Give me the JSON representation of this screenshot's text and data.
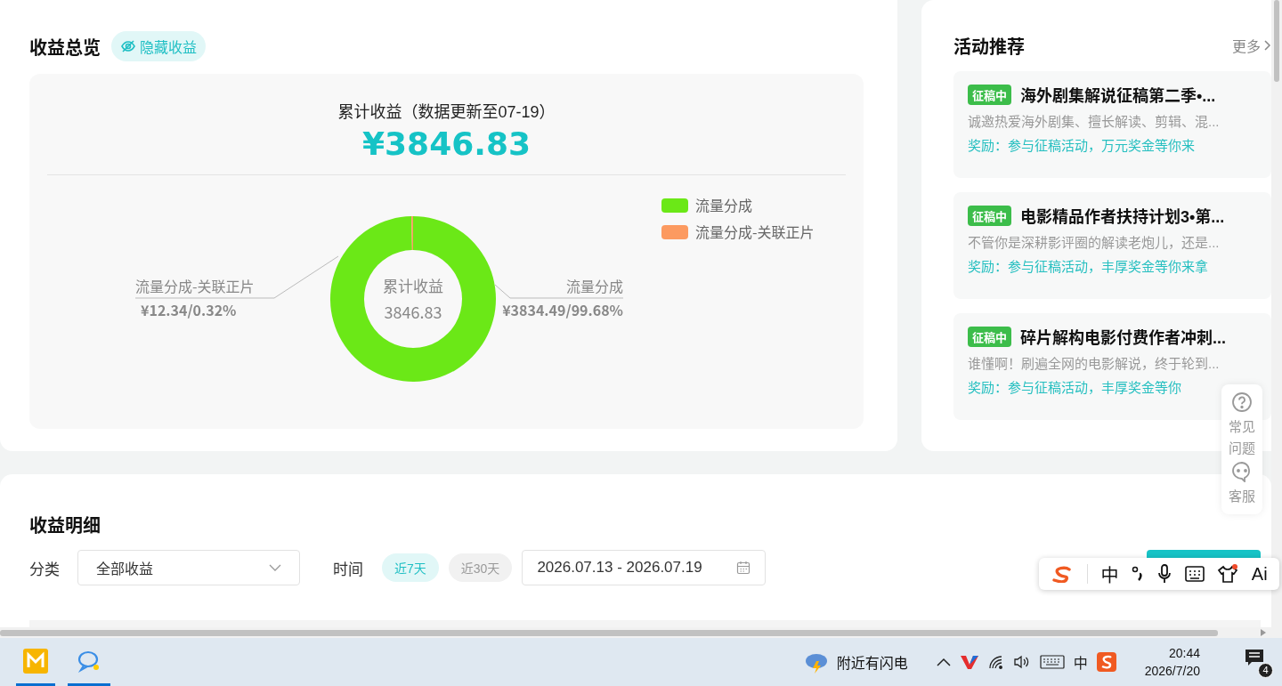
{
  "overview": {
    "title": "收益总览",
    "hide_button": "隐藏收益",
    "total_label": "累计收益（数据更新至07-19）",
    "total_amount": "¥3846.83",
    "chart_data": {
      "type": "donut",
      "categories": [
        "流量分成",
        "流量分成-关联正片"
      ],
      "series": [
        {
          "name": "累计收益",
          "values": [
            99.68,
            0.32
          ]
        }
      ],
      "legend": true
    },
    "slice_styles": [
      {
        "color": "#6be817"
      },
      {
        "color": "#fc9a60"
      }
    ],
    "center_value": "3846.83",
    "slice_labels": [
      {
        "name": "流量分成-关联正片",
        "value": "¥12.34/0.32%"
      },
      {
        "name": "流量分成",
        "value": "¥3834.49/99.68%"
      }
    ]
  },
  "activities": {
    "title": "活动推荐",
    "more": "更多",
    "items": [
      {
        "tag": "征稿中",
        "title": "海外剧集解说征稿第二季•...",
        "desc": "诚邀热爱海外剧集、擅长解读、剪辑、混...",
        "reward": "奖励：参与征稿活动，万元奖金等你来"
      },
      {
        "tag": "征稿中",
        "title": "电影精品作者扶持计划3•第...",
        "desc": "不管你是深耕影评圈的解读老炮儿，还是...",
        "reward": "奖励：参与征稿活动，丰厚奖金等你来拿"
      },
      {
        "tag": "征稿中",
        "title": "碎片解构电影付费作者冲刺...",
        "desc": "谁懂啊！刷遍全网的电影解说，终于轮到...",
        "reward": "奖励：参与征稿活动，丰厚奖金等你"
      }
    ]
  },
  "help": {
    "faq": "常见问题",
    "service": "客服"
  },
  "details": {
    "title": "收益明细",
    "category_label": "分类",
    "category_value": "全部收益",
    "time_label": "时间",
    "ranges": [
      {
        "label": "近7天",
        "selected": true
      },
      {
        "label": "近30天",
        "selected": false
      }
    ],
    "date_range": "2026.07.13 - 2026.07.19"
  },
  "ime": {
    "mode": "中",
    "ai": "Ai"
  },
  "taskbar": {
    "weather": "附近有闪电",
    "input_mode": "中",
    "time": "20:44",
    "date": "2026/7/20",
    "notifications": "4"
  }
}
